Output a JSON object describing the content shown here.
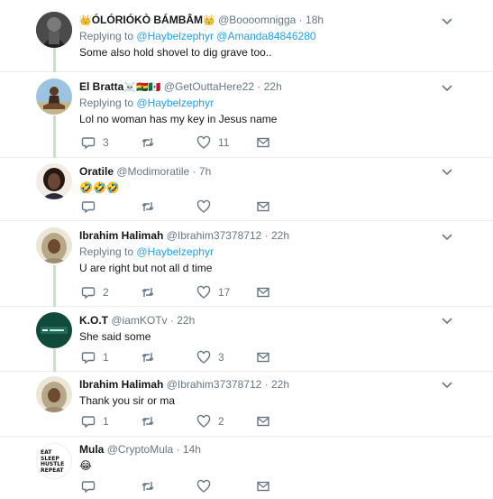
{
  "tweets": [
    {
      "name_emoji_pre": "👑",
      "name": "ÓLÓRIÓKÒ BÁMBÂM",
      "name_emoji_post": "👑",
      "handle": "@Boooomnigga",
      "time": "18h",
      "reply_prefix": "Replying to",
      "reply_to": "@Haybelzephyr @Amanda84846280",
      "text": "Some also hold shovel  to dig grave too..",
      "avatar_colors": [
        "#2a2a2a",
        "#6b6b6b"
      ]
    },
    {
      "name": "El Bratta",
      "name_emoji_post": "☠️🇬🇭🇲🇽",
      "handle": "@GetOuttaHere22",
      "time": "22h",
      "reply_prefix": "Replying to",
      "reply_to": "@Haybelzephyr",
      "text": "Lol no woman has my key in Jesus name",
      "replies": "3",
      "retweets": "",
      "likes": "11",
      "avatar_colors": [
        "#8fb6d8",
        "#6b4a2c"
      ]
    },
    {
      "name": "Oratile",
      "handle": "@Modimoratile",
      "time": "7h",
      "text": "🤣🤣🤣",
      "replies": "",
      "retweets": "",
      "likes": "",
      "avatar_colors": [
        "#f1e6dc",
        "#2b1d16"
      ]
    },
    {
      "name": "Ibrahim Halimah",
      "handle": "@Ibrahim37378712",
      "time": "22h",
      "reply_prefix": "Replying to",
      "reply_to": "@Haybelzephyr",
      "text": "U are right but not all d time",
      "replies": "2",
      "retweets": "",
      "likes": "17",
      "avatar_colors": [
        "#e9e2d3",
        "#4a3322"
      ]
    },
    {
      "name": "K.O.T",
      "handle": "@iamKOTv",
      "time": "22h",
      "text": "She said some",
      "replies": "1",
      "retweets": "",
      "likes": "3",
      "avatar_colors": [
        "#0f4a3b",
        "#ffffff"
      ]
    },
    {
      "name": "Ibrahim Halimah",
      "handle": "@Ibrahim37378712",
      "time": "22h",
      "text": "Thank you sir or ma",
      "replies": "1",
      "retweets": "",
      "likes": "2",
      "avatar_colors": [
        "#e9e2d3",
        "#4a3322"
      ]
    },
    {
      "name": "Mula",
      "handle": "@CryptoMula",
      "time": "14h",
      "text": "😂",
      "replies": "",
      "retweets": "",
      "likes": "",
      "avatar_text": [
        "EAT",
        "SLEEP",
        "HUSTLE",
        "REPEAT"
      ],
      "avatar_colors": [
        "#ffffff",
        "#111111"
      ]
    }
  ],
  "ui": {
    "dot": "·",
    "accent": "#1da1f2",
    "muted": "#657786",
    "thread_line": "#c4e6bd"
  }
}
